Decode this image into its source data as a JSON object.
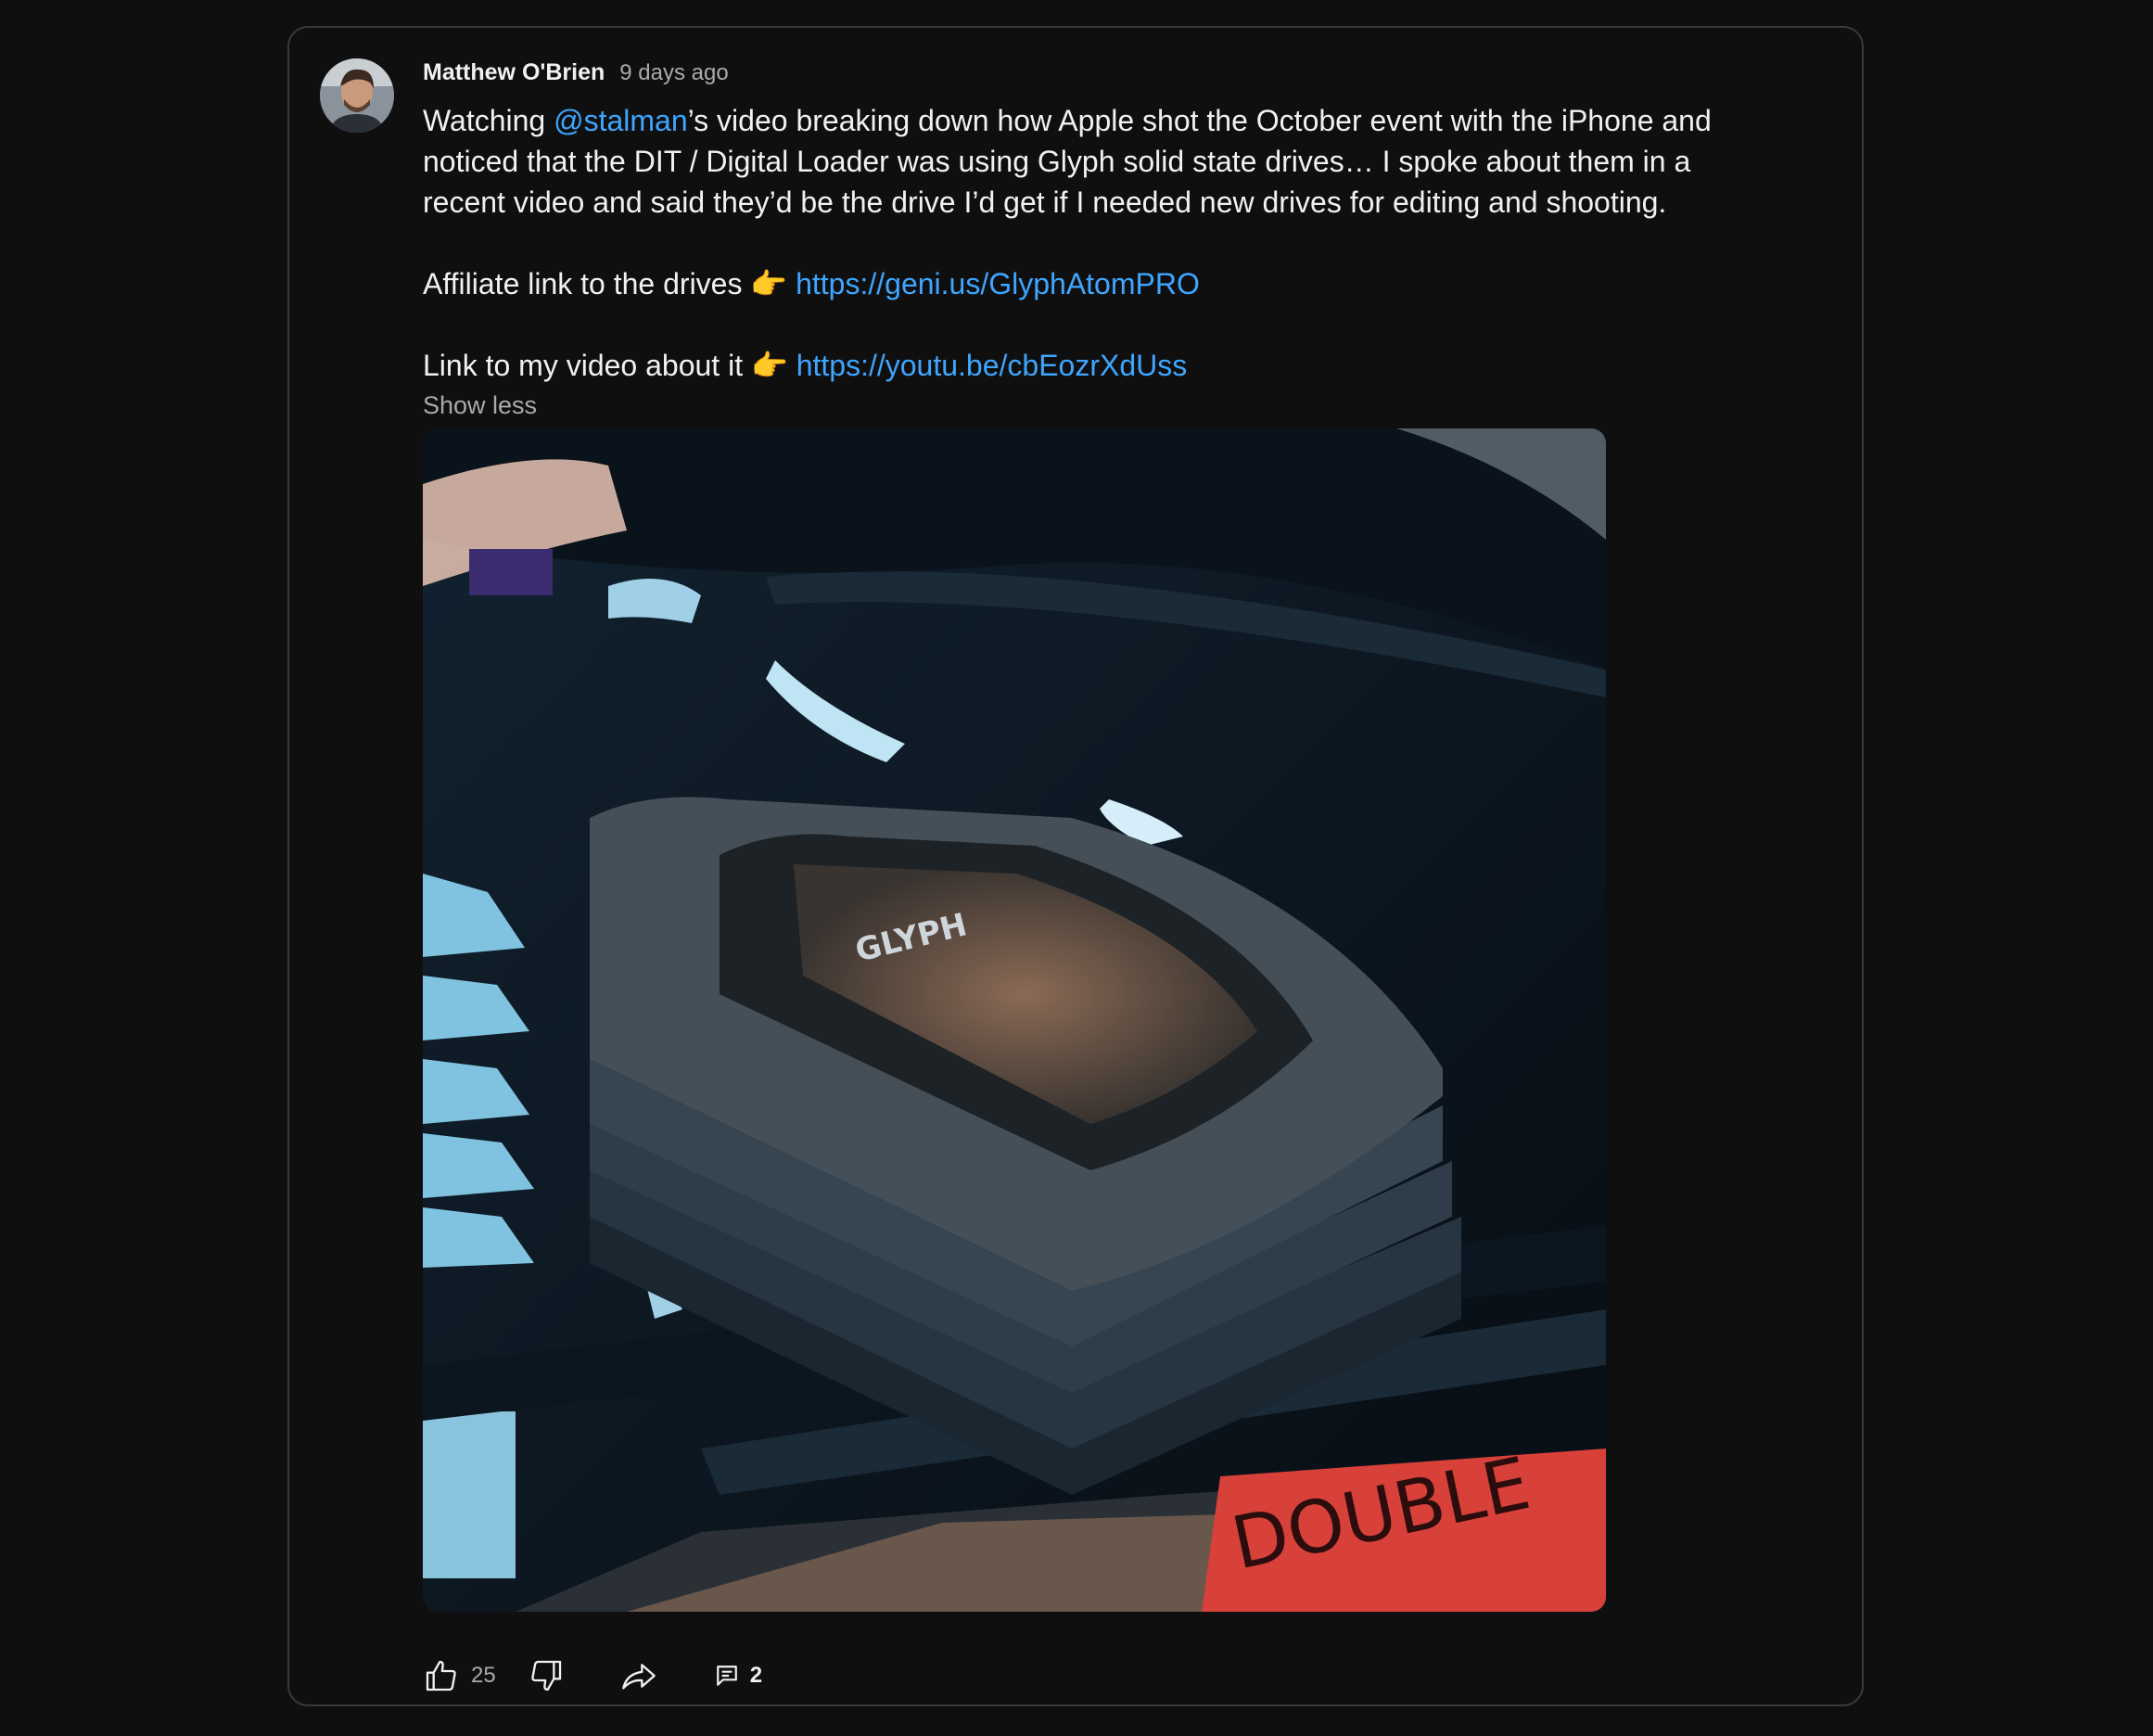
{
  "post": {
    "author": "Matthew O'Brien",
    "time": "9 days ago",
    "body": {
      "p1_prefix": "Watching ",
      "mention": "@stalman",
      "p1_suffix": "’s video breaking down how Apple shot the October event with the iPhone and noticed that the DIT / Digital Loader was using Glyph solid state drives… I spoke about them in a recent video and said they’d be the drive I’d get if I needed new drives for editing and shooting.",
      "p2_text": "Affiliate link to the drives ",
      "p2_emoji": "👉",
      "p2_link": "https://geni.us/GlyphAtomPRO",
      "p3_text": "Link to my video about it ",
      "p3_emoji": "👉",
      "p3_link": "https://youtu.be/cbEozrXdUss"
    },
    "show_less": "Show less",
    "image": {
      "drive_logo": "GLYPH",
      "sign_text": "DOUBLE"
    }
  },
  "actions": {
    "like_count": "25",
    "reply_count": "2",
    "icons": [
      "thumb-up-icon",
      "thumb-down-icon",
      "share-icon",
      "comment-icon"
    ]
  },
  "colors": {
    "background": "#0f0f0f",
    "text": "#f1f1f1",
    "secondary_text": "#aaaaaa",
    "link": "#3ea6ff",
    "border": "#3a3a3a"
  }
}
